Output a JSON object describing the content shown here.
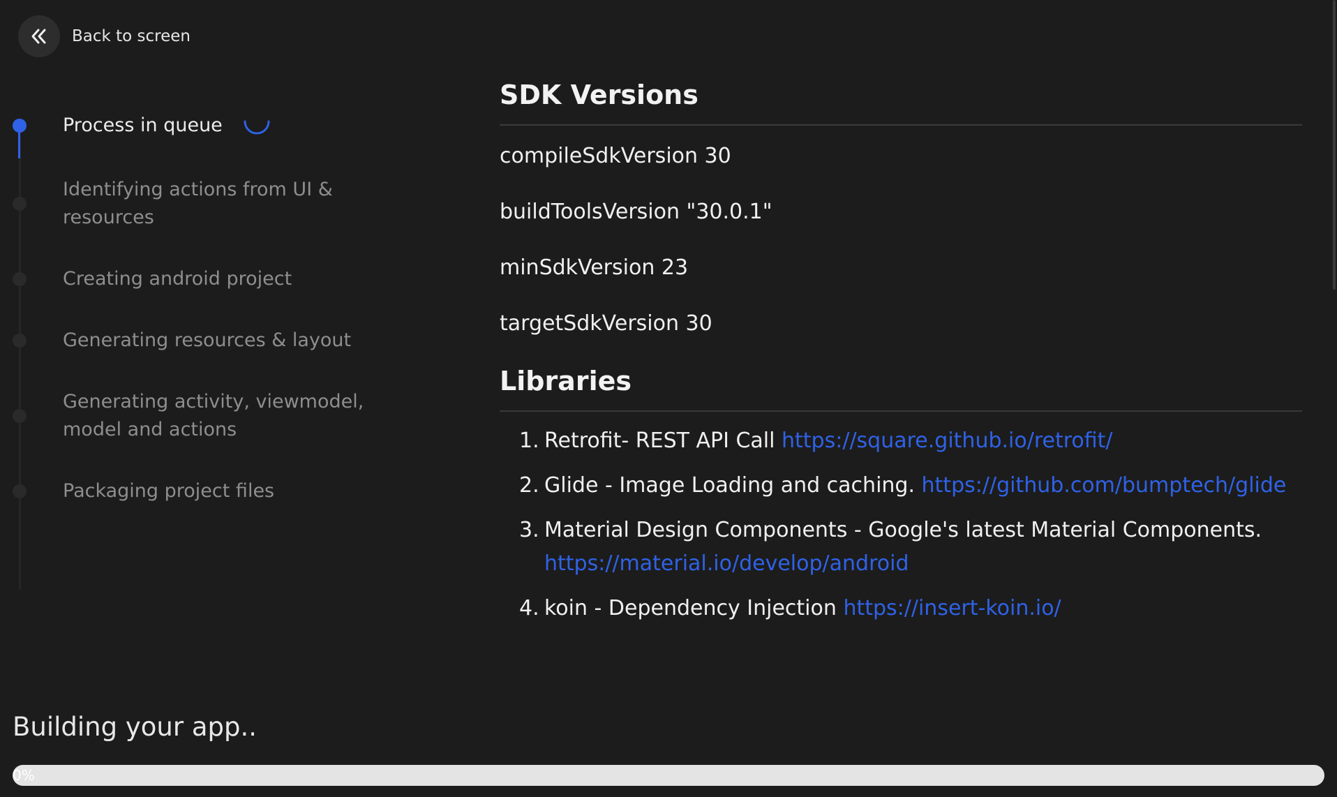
{
  "back": {
    "label": "Back to screen"
  },
  "steps": [
    {
      "label": "Process in queue",
      "active": true
    },
    {
      "label": "Identifying actions from UI & resources",
      "active": false
    },
    {
      "label": "Creating android project",
      "active": false
    },
    {
      "label": "Generating resources & layout",
      "active": false
    },
    {
      "label": "Generating activity, viewmodel, model and actions",
      "active": false
    },
    {
      "label": "Packaging project files",
      "active": false
    }
  ],
  "sdk": {
    "title": "SDK Versions",
    "items": [
      "compileSdkVersion 30",
      "buildToolsVersion \"30.0.1\"",
      "minSdkVersion 23",
      "targetSdkVersion 30"
    ]
  },
  "libraries": {
    "title": "Libraries",
    "items": [
      {
        "num": "1.",
        "text": "Retrofit- REST API Call ",
        "link": "https://square.github.io/retrofit/"
      },
      {
        "num": "2.",
        "text": "Glide - Image Loading and caching. ",
        "link": "https://github.com/bumptech/glide"
      },
      {
        "num": "3.",
        "text": "Material Design Components - Google's latest Material Components. ",
        "link": "https://material.io/develop/android"
      },
      {
        "num": "4.",
        "text": "koin - Dependency Injection ",
        "link": "https://insert-koin.io/"
      }
    ]
  },
  "build": {
    "status": "Building your app..",
    "progress_value": 0,
    "progress_text": "0%"
  },
  "colors": {
    "accent": "#2f62e6",
    "background": "#1c1c1c"
  }
}
